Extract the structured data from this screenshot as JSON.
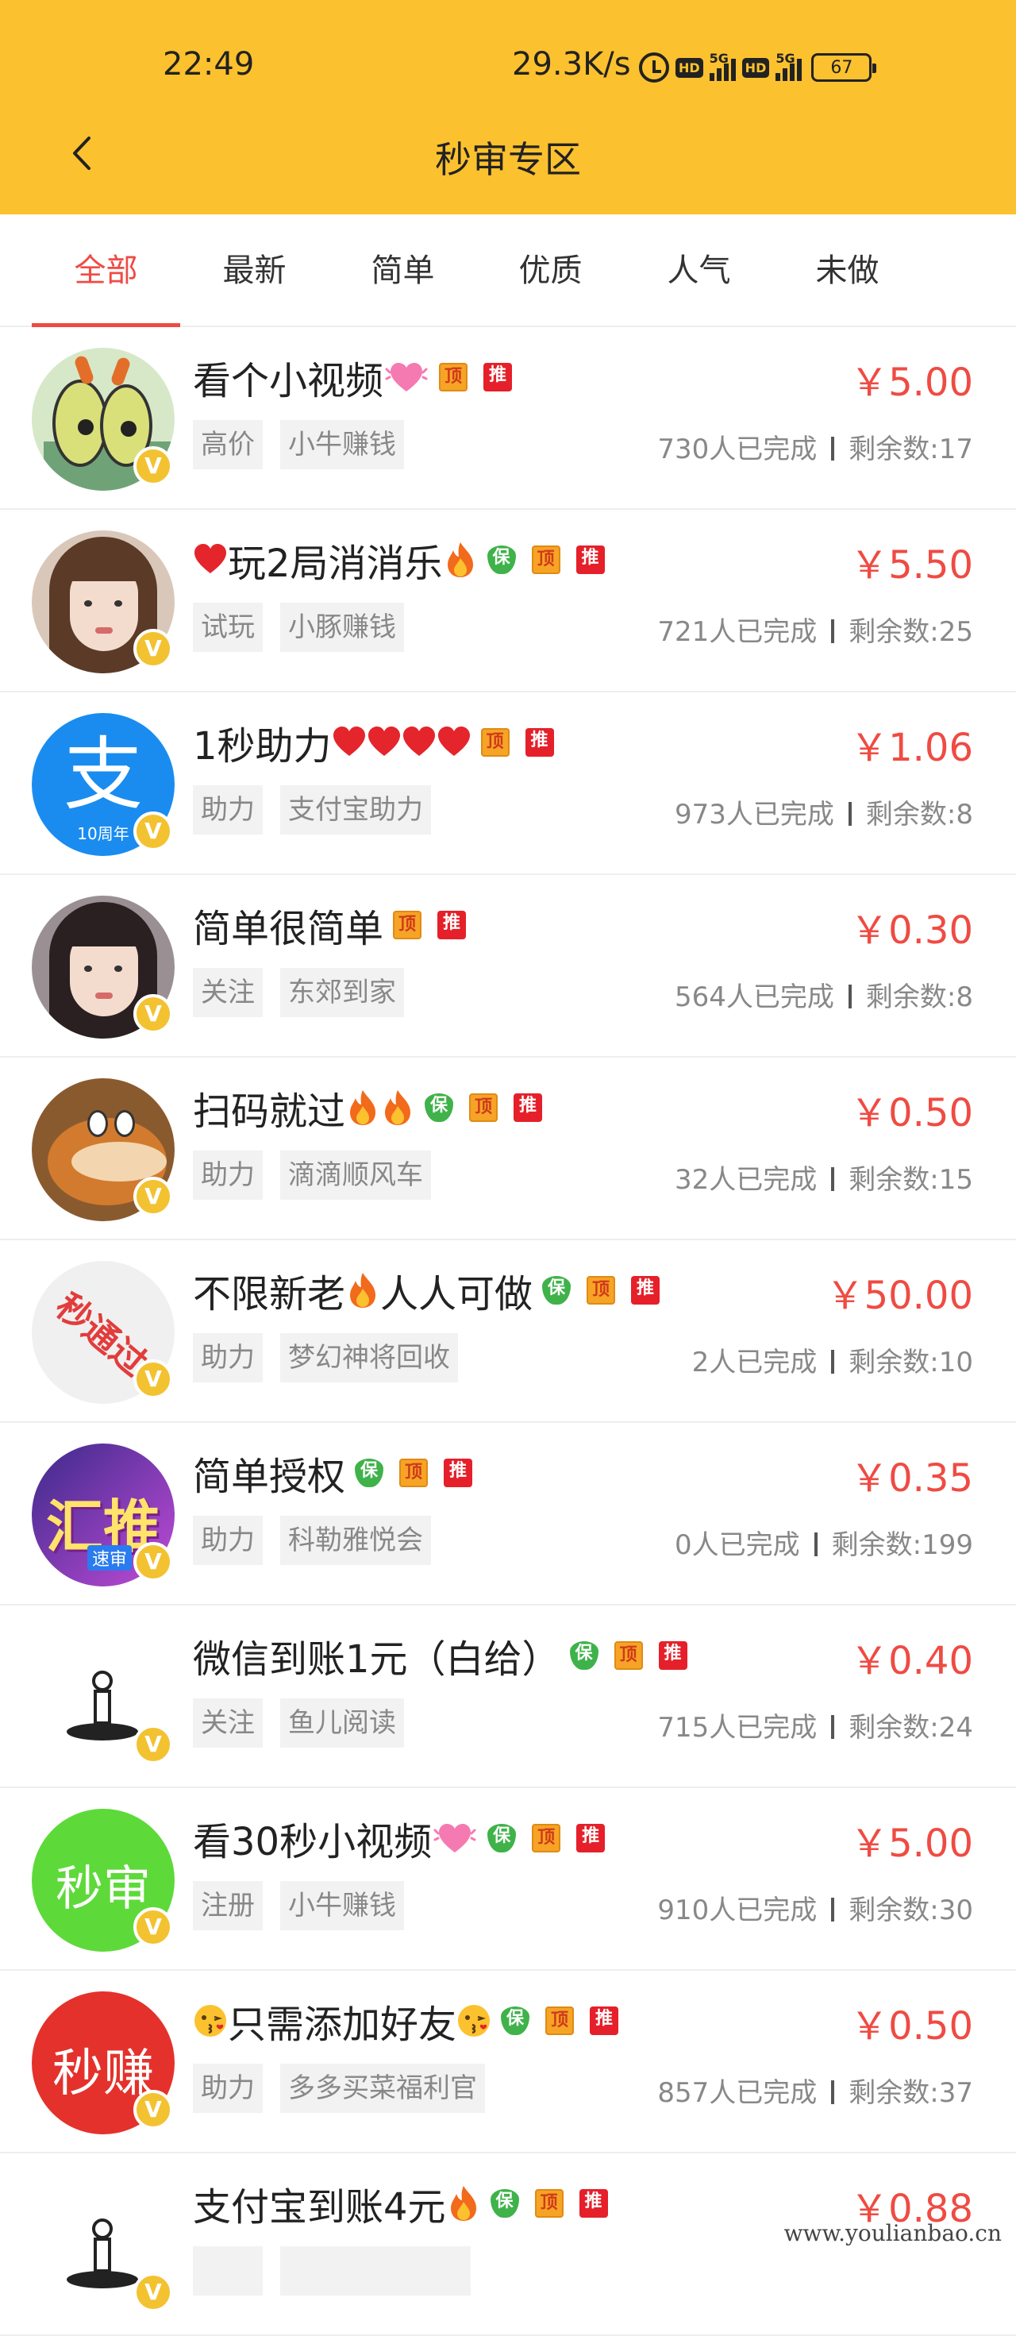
{
  "status_bar": {
    "time": "22:49",
    "net_speed": "29.3K/s",
    "hd1": "HD",
    "sig1": "5G",
    "hd2": "HD",
    "sig2": "5G",
    "battery": "67"
  },
  "header": {
    "title": "秒审专区",
    "back_icon": "chevron-left-icon"
  },
  "tabs": [
    {
      "label": "全部",
      "active": true
    },
    {
      "label": "最新"
    },
    {
      "label": "简单"
    },
    {
      "label": "优质"
    },
    {
      "label": "人气"
    },
    {
      "label": "未做"
    }
  ],
  "badge_labels": {
    "bao": "保",
    "ding": "顶",
    "tui": "推",
    "verified": "V"
  },
  "colors": {
    "header_bg": "#fcc12e",
    "accent": "#ef4b43",
    "chip_bg": "#f2f2f2",
    "bao": "#3fb24a",
    "ding": "#f6a425",
    "tui": "#e5202a"
  },
  "tasks": [
    {
      "title": "看个小视频",
      "emoji_after": [
        "heart-sparkle"
      ],
      "badges": [
        "ding",
        "tui"
      ],
      "price": "￥5.00",
      "chips": [
        "高价",
        "小牛赚钱"
      ],
      "completed": "730人已完成",
      "remaining": "剩余数:17",
      "avatar": "cartoon-avatar"
    },
    {
      "title": "玩2局消消乐",
      "emoji_before": [
        "heart"
      ],
      "emoji_after": [
        "fire"
      ],
      "badges": [
        "bao",
        "ding",
        "tui"
      ],
      "price": "￥5.50",
      "chips": [
        "试玩",
        "小豚赚钱"
      ],
      "completed": "721人已完成",
      "remaining": "剩余数:25",
      "avatar": "photo-avatar"
    },
    {
      "title": "1秒助力",
      "emoji_after": [
        "heart",
        "heart",
        "heart",
        "heart"
      ],
      "badges": [
        "ding",
        "tui"
      ],
      "price": "￥1.06",
      "chips": [
        "助力",
        "支付宝助力"
      ],
      "completed": "973人已完成",
      "remaining": "剩余数:8",
      "avatar": "alipay-avatar",
      "avatar_text": "支",
      "avatar_sub": "10周年"
    },
    {
      "title": "简单很简单",
      "badges": [
        "ding",
        "tui"
      ],
      "price": "￥0.30",
      "chips": [
        "关注",
        "东郊到家"
      ],
      "completed": "564人已完成",
      "remaining": "剩余数:8",
      "avatar": "photo-avatar-2"
    },
    {
      "title": "扫码就过",
      "emoji_after": [
        "fire",
        "fire"
      ],
      "badges": [
        "bao",
        "ding",
        "tui"
      ],
      "price": "￥0.50",
      "chips": [
        "助力",
        "滴滴顺风车"
      ],
      "completed": "32人已完成",
      "remaining": "剩余数:15",
      "avatar": "cartoon-avatar-2"
    },
    {
      "title": "不限新老",
      "emoji_after": [
        "fire"
      ],
      "title_suffix": "人人可做",
      "badges": [
        "bao",
        "ding",
        "tui"
      ],
      "price": "￥50.00",
      "chips": [
        "助力",
        "梦幻神将回收"
      ],
      "completed": "2人已完成",
      "remaining": "剩余数:10",
      "avatar": "stamp-avatar",
      "avatar_text": "秒通过"
    },
    {
      "title": "简单授权",
      "badges": [
        "bao",
        "ding",
        "tui"
      ],
      "price": "￥0.35",
      "chips": [
        "助力",
        "科勒雅悦会"
      ],
      "completed": "0人已完成",
      "remaining": "剩余数:199",
      "avatar": "huitui-avatar",
      "avatar_text": "汇推",
      "avatar_sub": "速审"
    },
    {
      "title": "微信到账1元（白给）",
      "badges": [
        "bao",
        "ding",
        "tui"
      ],
      "price": "￥0.40",
      "chips": [
        "关注",
        "鱼儿阅读"
      ],
      "completed": "715人已完成",
      "remaining": "剩余数:24",
      "avatar": "figure-avatar"
    },
    {
      "title": "看30秒小视频",
      "emoji_after": [
        "heart-sparkle"
      ],
      "badges": [
        "bao",
        "ding",
        "tui"
      ],
      "price": "￥5.00",
      "chips": [
        "注册",
        "小牛赚钱"
      ],
      "completed": "910人已完成",
      "remaining": "剩余数:30",
      "avatar": "green-avatar",
      "avatar_text": "秒审"
    },
    {
      "title": "只需添加好友",
      "emoji_before": [
        "kiss"
      ],
      "emoji_after": [
        "kiss"
      ],
      "badges": [
        "bao",
        "ding",
        "tui"
      ],
      "price": "￥0.50",
      "chips": [
        "助力",
        "多多买菜福利官"
      ],
      "completed": "857人已完成",
      "remaining": "剩余数:37",
      "avatar": "red-avatar",
      "avatar_text": "秒赚"
    },
    {
      "title": "支付宝到账4元",
      "emoji_after": [
        "fire"
      ],
      "badges": [
        "bao",
        "ding",
        "tui"
      ],
      "price": "￥0.88",
      "chips": [
        "",
        ""
      ],
      "completed": "",
      "remaining": "",
      "avatar": "figure-avatar"
    }
  ],
  "watermark": "www.youlianbao.cn"
}
